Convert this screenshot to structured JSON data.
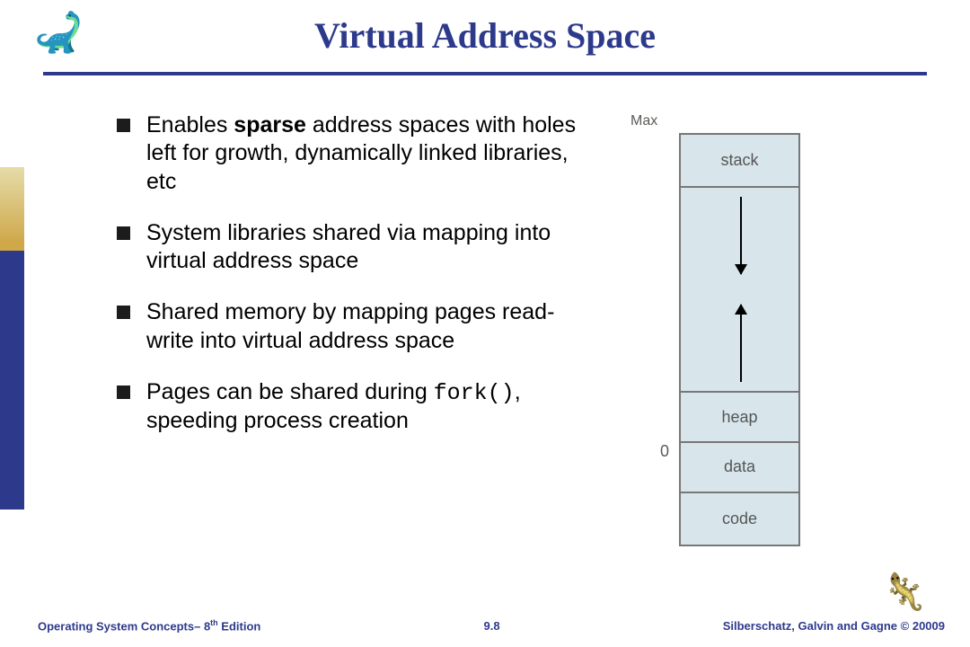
{
  "title": "Virtual Address Space",
  "bullets": {
    "b1_pre": "Enables ",
    "b1_bold": "sparse",
    "b1_post": " address spaces with holes left for growth, dynamically linked libraries, etc",
    "b2": "System libraries shared via mapping into virtual address space",
    "b3": "Shared memory by mapping pages read-write into virtual address space",
    "b4_pre": "Pages can be shared during ",
    "b4_code": "fork()",
    "b4_post": ", speeding process creation"
  },
  "diagram": {
    "max": "Max",
    "zero": "0",
    "stack": "stack",
    "heap": "heap",
    "data": "data",
    "code": "code"
  },
  "footer": {
    "book_pre": "Operating System Concepts– 8",
    "book_sup": "th",
    "book_post": " Edition",
    "page": "9.8",
    "credits": "Silberschatz, Galvin and Gagne © 20009"
  }
}
